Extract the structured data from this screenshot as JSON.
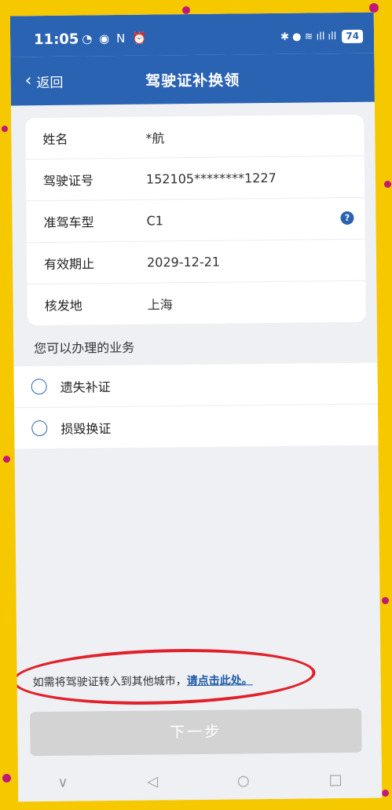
{
  "status": {
    "time": "11:05",
    "left_icons": "◔ ◉ N ⏰",
    "right_icons": "✱ ● ≋ ıll ıll",
    "battery": "74"
  },
  "nav": {
    "back_label": "返回",
    "title": "驾驶证补换领"
  },
  "info": {
    "rows": [
      {
        "label": "姓名",
        "value": "*航"
      },
      {
        "label": "驾驶证号",
        "value": "152105********1227"
      },
      {
        "label": "准驾车型",
        "value": "C1"
      },
      {
        "label": "有效期止",
        "value": "2029-12-21"
      },
      {
        "label": "核发地",
        "value": "上海"
      }
    ]
  },
  "services": {
    "title": "您可以办理的业务",
    "options": [
      "遗失补证",
      "损毁换证"
    ]
  },
  "transfer": {
    "text": "如需将驾驶证转入到其他城市，",
    "link": "请点击此处。"
  },
  "next_button": "下一步",
  "system_nav": {
    "down": "∨",
    "back": "◁",
    "home": "○",
    "recent": "□"
  },
  "colors": {
    "primary": "#2b63b3",
    "frame": "#f6c800",
    "annotation": "#e2202a"
  }
}
